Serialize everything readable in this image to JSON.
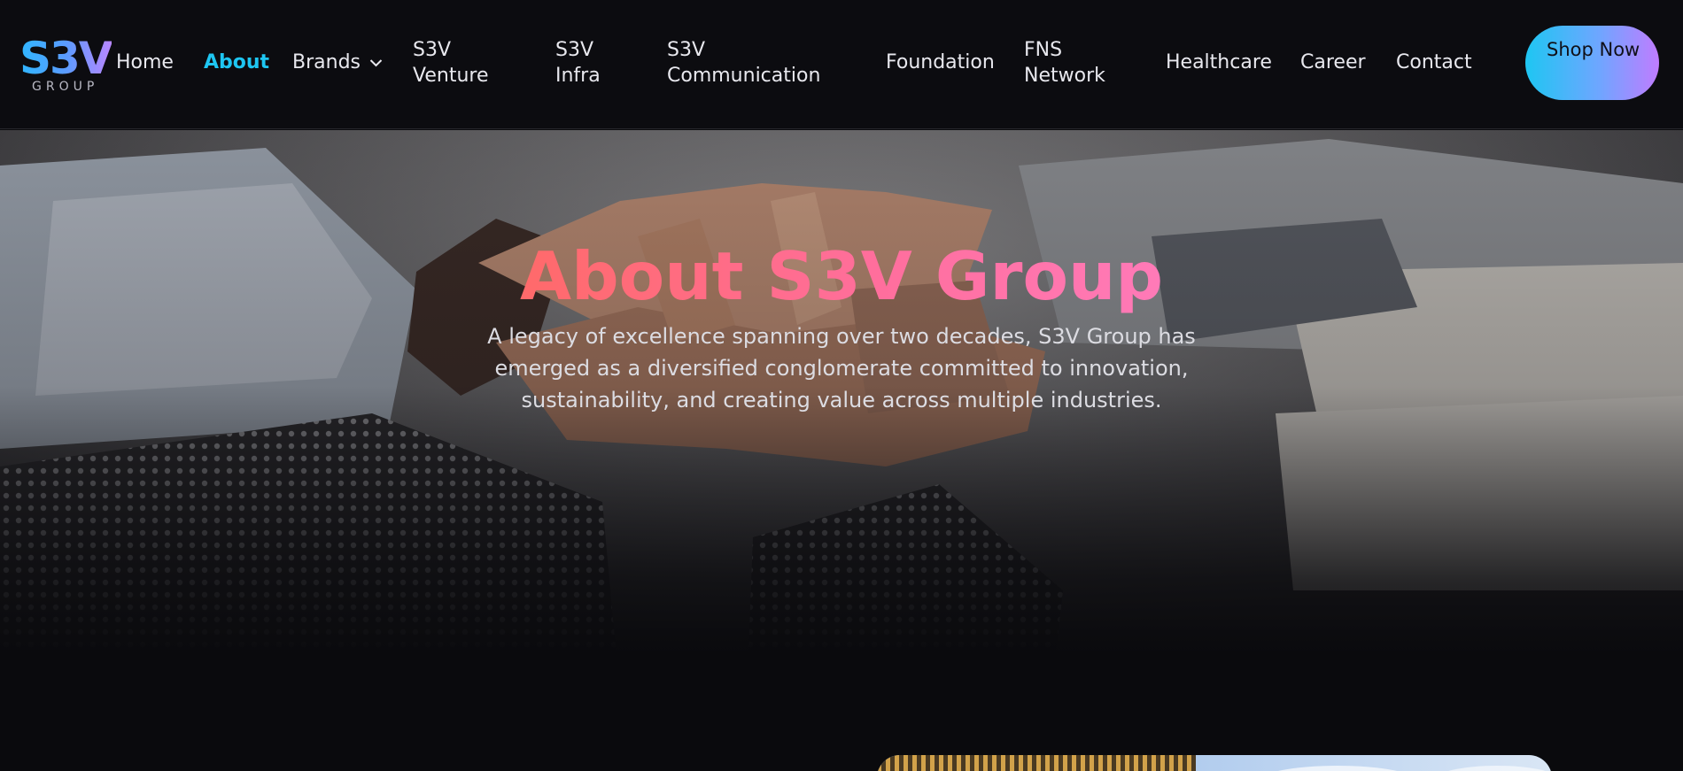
{
  "brand": {
    "logo_main": "S3V",
    "logo_sub": "GROUP"
  },
  "nav": {
    "items": [
      {
        "label": "Home",
        "active": false
      },
      {
        "label": "About",
        "active": true
      },
      {
        "label": "Brands",
        "active": false,
        "has_dropdown": true
      },
      {
        "label": "S3V Venture",
        "active": false
      },
      {
        "label": "S3V Infra",
        "active": false
      },
      {
        "label": "S3V Communication",
        "active": false
      },
      {
        "label": "Foundation",
        "active": false
      },
      {
        "label": "FNS Network",
        "active": false
      },
      {
        "label": "Healthcare",
        "active": false
      },
      {
        "label": "Career",
        "active": false
      },
      {
        "label": "Contact",
        "active": false
      }
    ],
    "cta_label": "Shop Now"
  },
  "hero": {
    "title": "About S3V Group",
    "description": "A legacy of excellence spanning over two decades, S3V Group has emerged as a diversified conglomerate committed to innovation, sustainability, and creating value across multiple industries."
  },
  "colors": {
    "background": "#0a0a0d",
    "nav_active": "#1ec6f2",
    "title_gradient_start": "#ff6a6a",
    "title_gradient_end": "#ff7ab8",
    "cta_gradient_start": "#1ec6f2",
    "cta_gradient_end": "#c07cff"
  },
  "icons": {
    "brands_dropdown": "chevron-down-icon"
  }
}
